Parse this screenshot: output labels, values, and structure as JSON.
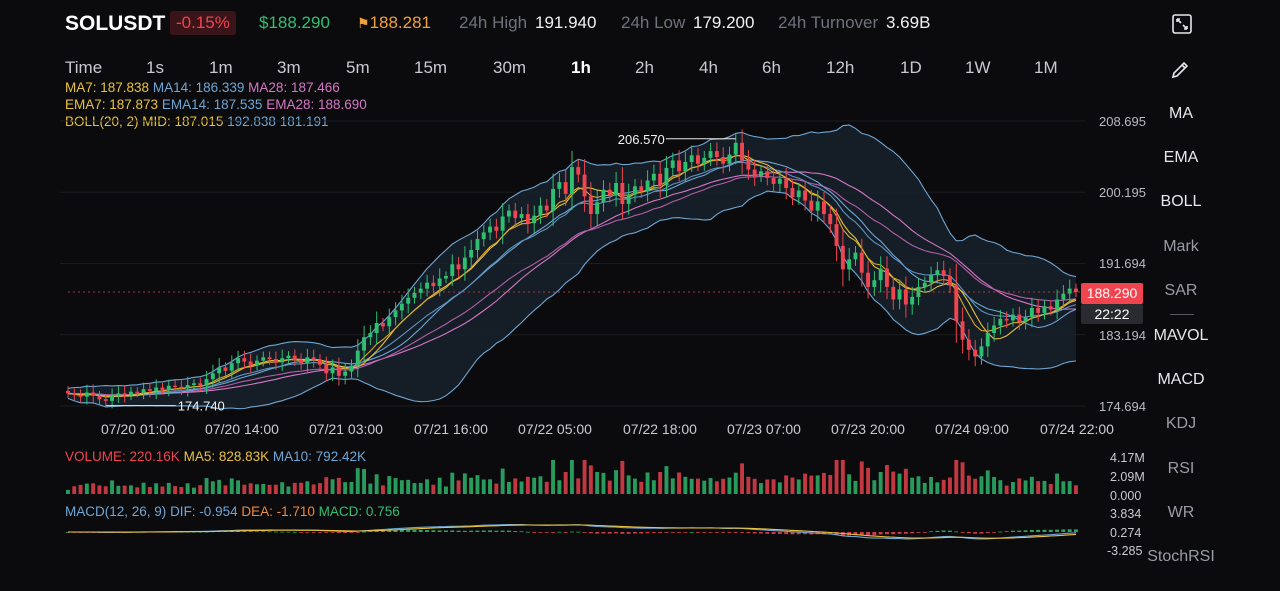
{
  "header": {
    "symbol": "SOLUSDT",
    "change": "-0.15%",
    "last_price": "$188.290",
    "mark_price": "188.281",
    "high_label": "24h High",
    "high_value": "191.940",
    "low_label": "24h Low",
    "low_value": "179.200",
    "turnover_label": "24h Turnover",
    "turnover_value": "3.69B"
  },
  "timeframes": [
    "Time",
    "1s",
    "1m",
    "3m",
    "5m",
    "15m",
    "30m",
    "1h",
    "2h",
    "4h",
    "6h",
    "12h",
    "1D",
    "1W",
    "1M"
  ],
  "active_timeframe": "1h",
  "legends": {
    "ma": {
      "ma7": "MA7: 187.838",
      "ma14": "MA14: 186.339",
      "ma28": "MA28: 187.466"
    },
    "ema": {
      "ema7": "EMA7: 187.873",
      "ema14": "EMA14: 187.535",
      "ema28": "EMA28: 188.690"
    },
    "boll": {
      "label": "BOLL(20, 2) MID: 187.015",
      "upper": "192.838",
      "lower": "181.191"
    },
    "volume": {
      "vol": "VOLUME: 220.16K",
      "ma5": "MA5: 828.83K",
      "ma10": "MA10: 792.42K"
    },
    "macd": {
      "label": "MACD(12, 26, 9)",
      "dif": "DIF: -0.954",
      "dea": "DEA: -1.710",
      "macd": "MACD: 0.756"
    }
  },
  "side_menu": [
    "MA",
    "EMA",
    "BOLL",
    "Mark",
    "SAR",
    "MAVOL",
    "MACD",
    "KDJ",
    "RSI",
    "WR",
    "StochRSI"
  ],
  "price_axis": [
    "208.695",
    "200.195",
    "191.694",
    "183.194",
    "174.694"
  ],
  "time_axis": [
    "07/20 01:00",
    "07/20 14:00",
    "07/21 03:00",
    "07/21 16:00",
    "07/22 05:00",
    "07/22 18:00",
    "07/23 07:00",
    "07/23 20:00",
    "07/24 09:00",
    "07/24 22:00"
  ],
  "volume_axis": [
    "4.17M",
    "2.09M",
    "0.000"
  ],
  "macd_axis": [
    "3.834",
    "0.274",
    "-3.285"
  ],
  "current_price_tag": "188.290",
  "countdown": "22:22",
  "annotations": {
    "high": "206.570",
    "low": "174.740"
  },
  "colors": {
    "up": "#2fbf71",
    "down": "#f0444f",
    "background": "#0b0b0e",
    "boll_fill": "#17212b"
  },
  "chart_data": {
    "type": "candlestick",
    "symbol": "SOLUSDT",
    "interval": "1h",
    "ylim": [
      174.694,
      208.695
    ],
    "close": [
      176.2,
      176.0,
      175.8,
      176.3,
      175.9,
      175.5,
      175.3,
      175.9,
      176.2,
      176.0,
      176.4,
      176.3,
      176.7,
      176.5,
      176.9,
      176.6,
      177.1,
      177.0,
      176.8,
      177.2,
      177.4,
      177.1,
      177.9,
      178.6,
      179.3,
      178.9,
      179.8,
      180.4,
      180.0,
      179.6,
      180.1,
      180.5,
      180.3,
      179.9,
      180.4,
      180.7,
      180.2,
      179.8,
      180.5,
      180.2,
      179.6,
      178.6,
      179.3,
      178.3,
      178.8,
      179.5,
      181.3,
      182.9,
      183.4,
      184.6,
      184.2,
      185.3,
      186.1,
      186.9,
      187.6,
      188.2,
      188.7,
      189.4,
      189.0,
      189.9,
      190.2,
      191.6,
      191.0,
      192.4,
      193.3,
      194.6,
      195.4,
      196.1,
      195.6,
      197.3,
      198.0,
      197.1,
      197.6,
      196.5,
      197.4,
      198.6,
      198.0,
      200.6,
      201.4,
      200.0,
      203.2,
      202.3,
      199.7,
      197.6,
      199.0,
      200.5,
      199.8,
      201.3,
      198.8,
      199.9,
      200.9,
      200.3,
      201.6,
      202.4,
      201.0,
      203.1,
      204.0,
      202.7,
      203.8,
      204.6,
      203.6,
      204.3,
      205.1,
      204.4,
      203.6,
      204.7,
      206.1,
      204.0,
      202.9,
      202.1,
      202.7,
      201.9,
      201.2,
      201.8,
      200.7,
      199.6,
      200.4,
      199.2,
      198.0,
      199.1,
      197.6,
      196.4,
      193.8,
      191.0,
      192.2,
      193.0,
      190.6,
      188.9,
      189.7,
      191.1,
      188.9,
      187.4,
      188.6,
      186.8,
      187.7,
      188.9,
      189.4,
      190.3,
      190.9,
      190.2,
      189.1,
      184.8,
      182.6,
      181.4,
      180.6,
      181.8,
      183.4,
      184.3,
      185.1,
      184.9,
      185.6,
      184.7,
      185.3,
      186.4,
      185.8,
      186.6,
      186.2,
      187.4,
      188.1,
      188.7,
      188.29
    ]
  }
}
